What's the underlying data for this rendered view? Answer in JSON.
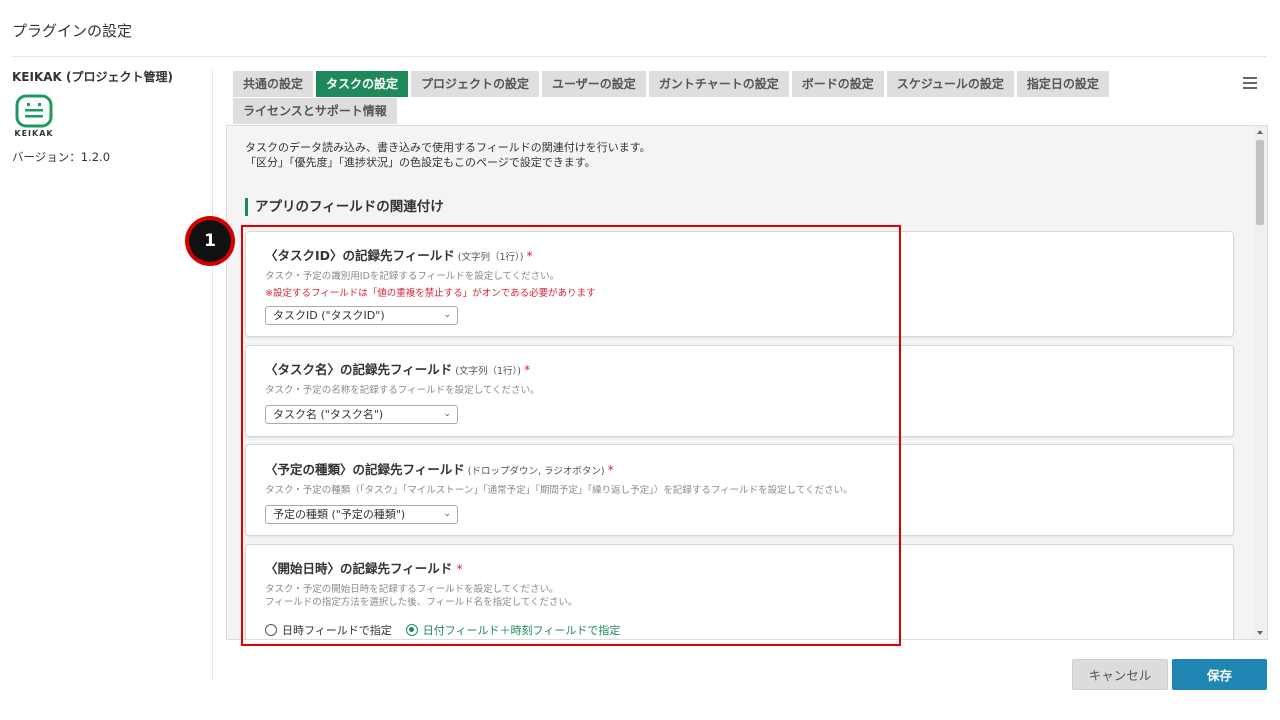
{
  "page": {
    "title": "プラグインの設定"
  },
  "plugin": {
    "name": "KEIKAK (プロジェクト管理)",
    "logo_text": "KEIKAK",
    "version": "バージョン：1.2.0"
  },
  "tabs": [
    {
      "label": "共通の設定",
      "active": false
    },
    {
      "label": "タスクの設定",
      "active": true
    },
    {
      "label": "プロジェクトの設定",
      "active": false
    },
    {
      "label": "ユーザーの設定",
      "active": false
    },
    {
      "label": "ガントチャートの設定",
      "active": false
    },
    {
      "label": "ボードの設定",
      "active": false
    },
    {
      "label": "スケジュールの設定",
      "active": false
    },
    {
      "label": "指定日の設定",
      "active": false
    },
    {
      "label": "ライセンスとサポート情報",
      "active": false
    }
  ],
  "intro": {
    "line1": "タスクのデータ読み込み、書き込みで使用するフィールドの関連付けを行います。",
    "line2": "「区分」「優先度」「進捗状況」の色設定もこのページで設定できます。"
  },
  "section": {
    "title": "アプリのフィールドの関連付け"
  },
  "cards": [
    {
      "title": "〈タスクID〉の記録先フィールド",
      "type": " (文字列（1行）) ",
      "required": "*",
      "description": "タスク・予定の識別用IDを記録するフィールドを設定してください。",
      "warning": "※設定するフィールドは「値の重複を禁止する」がオンである必要があります",
      "select_value": "タスクID (\"タスクID\")"
    },
    {
      "title": "〈タスク名〉の記録先フィールド",
      "type": " (文字列（1行）) ",
      "required": "*",
      "description": "タスク・予定の名称を記録するフィールドを設定してください。",
      "select_value": "タスク名 (\"タスク名\")"
    },
    {
      "title": "〈予定の種類〉の記録先フィールド",
      "type": " (ドロップダウン, ラジオボタン) ",
      "required": "*",
      "description": "タスク・予定の種類（「タスク」「マイルストーン」「通常予定」「期間予定」「繰り返し予定」）を記録するフィールドを設定してください。",
      "select_value": "予定の種類 (\"予定の種類\")"
    },
    {
      "title": "〈開始日時〉の記録先フィールド",
      "required": " *",
      "description": "タスク・予定の開始日時を記録するフィールドを設定してください。",
      "description2": "フィールドの指定方法を選択した後、フィールド名を指定してください。",
      "radio1": "日時フィールドで指定",
      "radio2": "日付フィールド＋時刻フィールドで指定"
    }
  ],
  "annotation": {
    "marker": "1"
  },
  "buttons": {
    "cancel": "キャンセル",
    "save": "保存"
  },
  "colors": {
    "accent_green": "#1e8a5a",
    "save_blue": "#1f86b4",
    "required_red": "#d9263b",
    "highlight_red": "#e00000"
  }
}
